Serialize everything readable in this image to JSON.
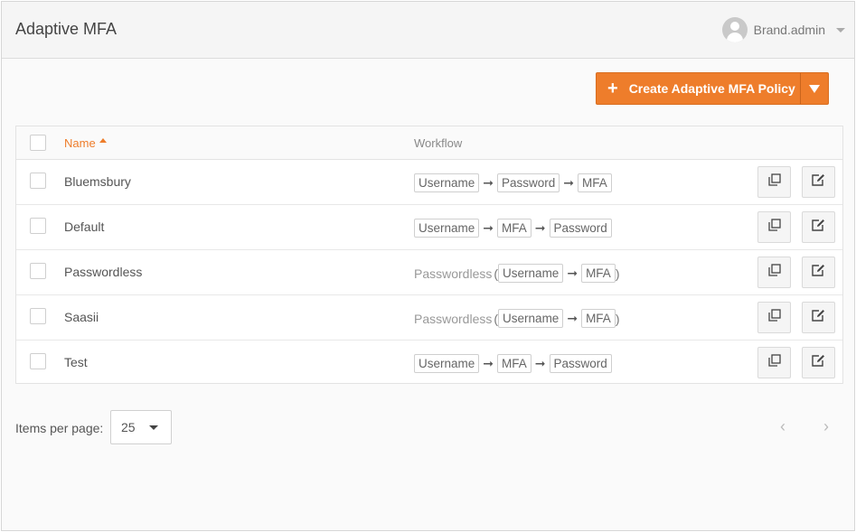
{
  "header": {
    "title": "Adaptive MFA",
    "user": {
      "name": "Brand.admin",
      "avatar_icon": "user-avatar-icon"
    }
  },
  "toolbar": {
    "create_label": "Create Adaptive MFA Policy",
    "create_icon": "plus-icon",
    "accent_color": "#ee7d2b"
  },
  "table": {
    "columns": {
      "name": "Name",
      "workflow": "Workflow"
    },
    "sort": {
      "column": "Name",
      "direction": "ascending"
    },
    "rows": [
      {
        "name": "Bluemsbury",
        "workflow_type": "",
        "steps": [
          "Username",
          "Password",
          "MFA"
        ]
      },
      {
        "name": "Default",
        "workflow_type": "",
        "steps": [
          "Username",
          "MFA",
          "Password"
        ]
      },
      {
        "name": "Passwordless",
        "workflow_type": "Passwordless",
        "steps": [
          "Username",
          "MFA"
        ]
      },
      {
        "name": "Saasii",
        "workflow_type": "Passwordless",
        "steps": [
          "Username",
          "MFA"
        ]
      },
      {
        "name": "Test",
        "workflow_type": "",
        "steps": [
          "Username",
          "MFA",
          "Password"
        ]
      }
    ],
    "row_actions": [
      "copy-icon",
      "edit-icon"
    ]
  },
  "pagination": {
    "items_per_page_label": "Items per page:",
    "items_per_page": "25",
    "prev_icon": "chevron-left-icon",
    "next_icon": "chevron-right-icon"
  }
}
